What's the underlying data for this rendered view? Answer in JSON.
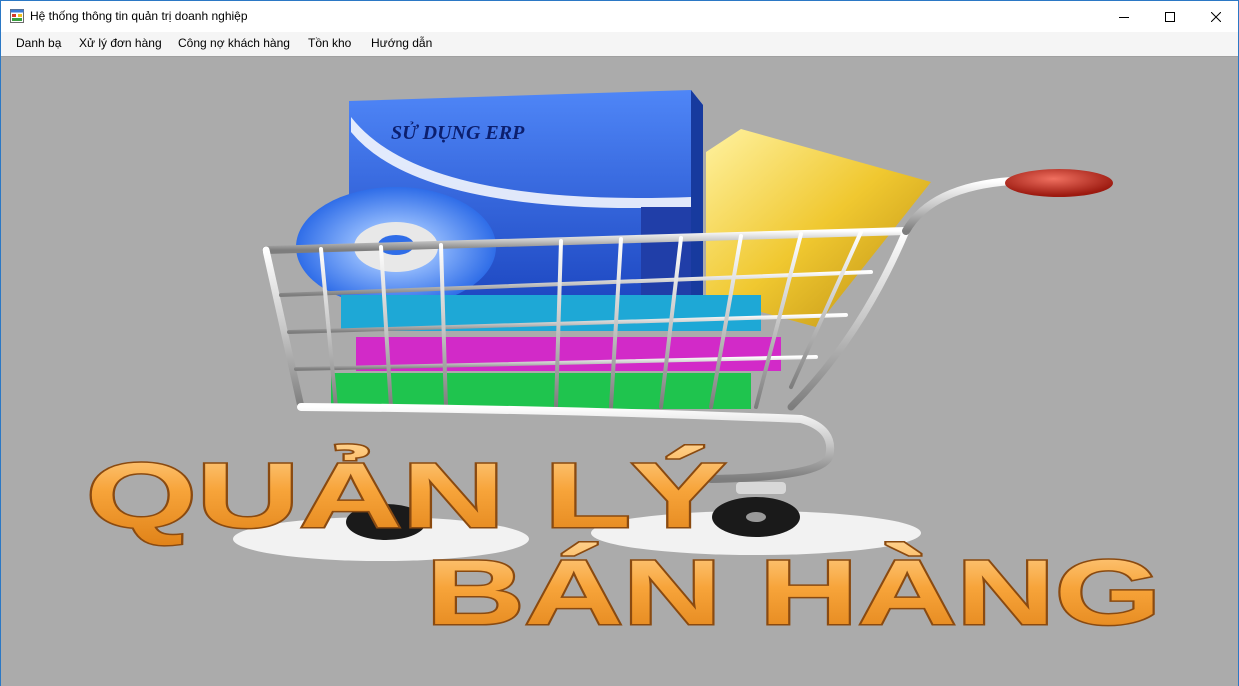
{
  "window": {
    "title": "Hệ thống thông tin quản trị doanh nghiệp"
  },
  "menu": {
    "items": [
      {
        "name": "menu-danh-ba",
        "label": "Danh bạ"
      },
      {
        "name": "menu-xu-ly-don-hang",
        "label": "Xử lý đơn hàng"
      },
      {
        "name": "menu-cong-no-khach-hang",
        "label": "Công nợ khách hàng"
      },
      {
        "name": "menu-ton-kho",
        "label": "Tồn kho"
      },
      {
        "name": "menu-huong-dan",
        "label": "Hướng dẫn"
      }
    ]
  },
  "banner": {
    "box_label": "SỬ DỤNG ERP",
    "headline_line1": "QUẢN LÝ",
    "headline_line2": "BÁN HÀNG"
  },
  "colors": {
    "client_background": "#ababab",
    "headline_orange": "#f7a43a",
    "box_blue": "#2a64e6",
    "cart_handle_red": "#c8261a"
  },
  "icons": {
    "app": "app-icon",
    "minimize": "minimize-icon",
    "maximize": "maximize-icon",
    "close": "close-icon"
  }
}
